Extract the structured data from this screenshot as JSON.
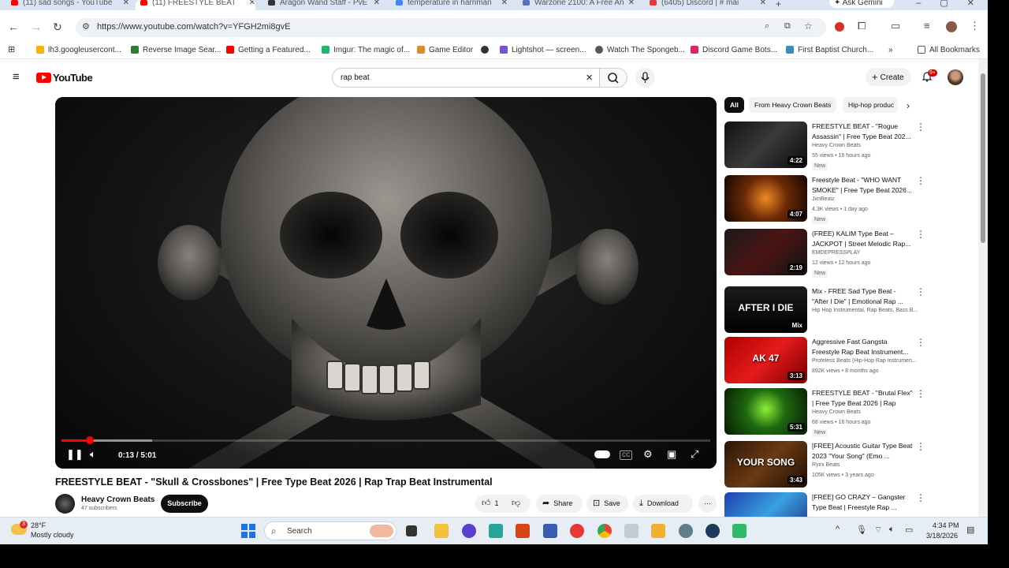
{
  "browser": {
    "tabs": [
      {
        "title": "(11) sad songs - YouTube",
        "color": "#ff0000",
        "active": false
      },
      {
        "title": "(11) FREESTYLE BEAT",
        "color": "#ff0000",
        "active": true
      },
      {
        "title": "Aragon Wand Staff - PvE",
        "color": "#333333",
        "active": false
      },
      {
        "title": "temperature in harriman",
        "color": "#4285f4",
        "active": false
      },
      {
        "title": "Warzone 2100: A Free An",
        "color": "#5b6ebd",
        "active": false
      },
      {
        "title": "(6405) Discord | # mai",
        "color": "#e03b3b",
        "active": false
      }
    ],
    "gemini_label": "Ask Gemini",
    "url": "https://www.youtube.com/watch?v=YFGH2mi8gvE",
    "bookmarks": [
      {
        "label": "lh3.googleusercont...",
        "color": "#f4b400"
      },
      {
        "label": "Reverse Image Sear...",
        "color": "#2e7d32"
      },
      {
        "label": "Getting a Featured...",
        "color": "#ff0000"
      },
      {
        "label": "Imgur: The magic of...",
        "color": "#1bb76e"
      },
      {
        "label": "Game Editor",
        "color": "#e08a2e"
      },
      {
        "label": "",
        "color": "#333333"
      },
      {
        "label": "Lightshot — screen...",
        "color": "#7b4fd6"
      },
      {
        "label": "Watch The Spongeb...",
        "color": "#555555"
      },
      {
        "label": "Discord Game Bots...",
        "color": "#e0245e"
      },
      {
        "label": "First Baptist Church...",
        "color": "#3a8bbf"
      }
    ],
    "all_bookmarks": "All Bookmarks"
  },
  "youtube": {
    "logo_text": "YouTube",
    "search_value": "rap beat",
    "create_label": "Create",
    "notif_count": "9+",
    "player": {
      "time": "0:13 / 5:01",
      "progress": 0.043
    },
    "video_title": "FREESTYLE BEAT - \"Skull & Crossbones\" | Free Type Beat 2026 | Rap Trap Beat Instrumental",
    "channel_name": "Heavy Crown Beats",
    "channel_subs": "47 subscribers",
    "subscribe_label": "Subscribe",
    "actions": {
      "like_count": "1",
      "share": "Share",
      "save": "Save",
      "download": "Download"
    },
    "chips": [
      "All",
      "From Heavy Crown Beats",
      "Hip-hop produc"
    ],
    "recommendations": [
      {
        "title": "FREESTYLE BEAT - \"Rogue Assassin\" | Free Type Beat 202...",
        "channel": "Heavy Crown Beats",
        "meta": "55 views • 16 hours ago",
        "badge": "New",
        "duration": "4:22",
        "thumb_label": "",
        "thumb_bg": "linear-gradient(135deg,#111 0%,#3a3a3a 50%,#0a0a0a 100%)"
      },
      {
        "title": "Freestyle Beat - \"WHO WANT SMOKE\" | Free Type Beat 2026...",
        "channel": "JxnBeatz",
        "meta": "4.3K views • 1 day ago",
        "badge": "New",
        "duration": "4:07",
        "thumb_label": "",
        "thumb_bg": "radial-gradient(circle at 50% 50%,#f08a24 0%,#6b2a06 45%,#140603 100%)"
      },
      {
        "title": "(FREE) KALIM Type Beat – JACKPOT | Street Melodic Rap...",
        "channel": "EMDEPRESSPLAY",
        "meta": "12 views • 12 hours ago",
        "badge": "New",
        "duration": "2:19",
        "thumb_label": "",
        "thumb_bg": "linear-gradient(135deg,#1a1a1a 0%,#4b1515 50%,#111 100%)"
      },
      {
        "title": "Mix - FREE Sad Type Beat - \"After I Die\" | Emotional Rap ...",
        "channel": "Hip Hop Instrumental, Rap Beats, Bass B...",
        "meta": "",
        "badge": "",
        "duration": "Mix",
        "thumb_label": "AFTER I DIE",
        "thumb_bg": "linear-gradient(180deg,#1c1c1c 0%,#000 100%)"
      },
      {
        "title": "Aggressive Fast Gangsta Freestyle Rap Beat Instrument...",
        "channel": "Profeless Beats (Hip-Hop Rap Instrumen...",
        "meta": "892K views • 8 months ago",
        "badge": "",
        "duration": "3:13",
        "thumb_label": "AK 47",
        "thumb_bg": "linear-gradient(135deg,#b00000 0%,#e51a1a 50%,#7a0000 100%)"
      },
      {
        "title": "FREESTYLE BEAT - \"Brutal Flex\" | Free Type Beat 2026 | Rap Tra...",
        "channel": "Heavy Crown Beats",
        "meta": "68 views • 16 hours ago",
        "badge": "New",
        "duration": "5:31",
        "thumb_label": "",
        "thumb_bg": "radial-gradient(circle at 50% 45%,#8cf03a 0%,#1f6a10 40%,#061a03 100%)"
      },
      {
        "title": "[FREE] Acoustic Guitar Type Beat 2023 \"Your Song\" (Emo ...",
        "channel": "Ryini Beats",
        "meta": "105K views • 3 years ago",
        "badge": "",
        "duration": "3:43",
        "thumb_label": "YOUR SONG",
        "thumb_bg": "linear-gradient(135deg,#2a1608 0%,#6b3a12 50%,#1a0d04 100%)"
      },
      {
        "title": "[FREE] GO CRAZY – Gangster Type Beat | Freestyle Rap ...",
        "channel": "",
        "meta": "",
        "badge": "",
        "duration": "",
        "thumb_label": "",
        "thumb_bg": "linear-gradient(135deg,#1d3fb0 0%,#3aa0e0 50%,#1b2b80 100%)"
      }
    ]
  },
  "taskbar": {
    "weather_temp": "28°F",
    "weather_desc": "Mostly cloudy",
    "weather_badge": "3",
    "search_label": "Search",
    "time": "4:34 PM",
    "date": "3/18/2026"
  }
}
